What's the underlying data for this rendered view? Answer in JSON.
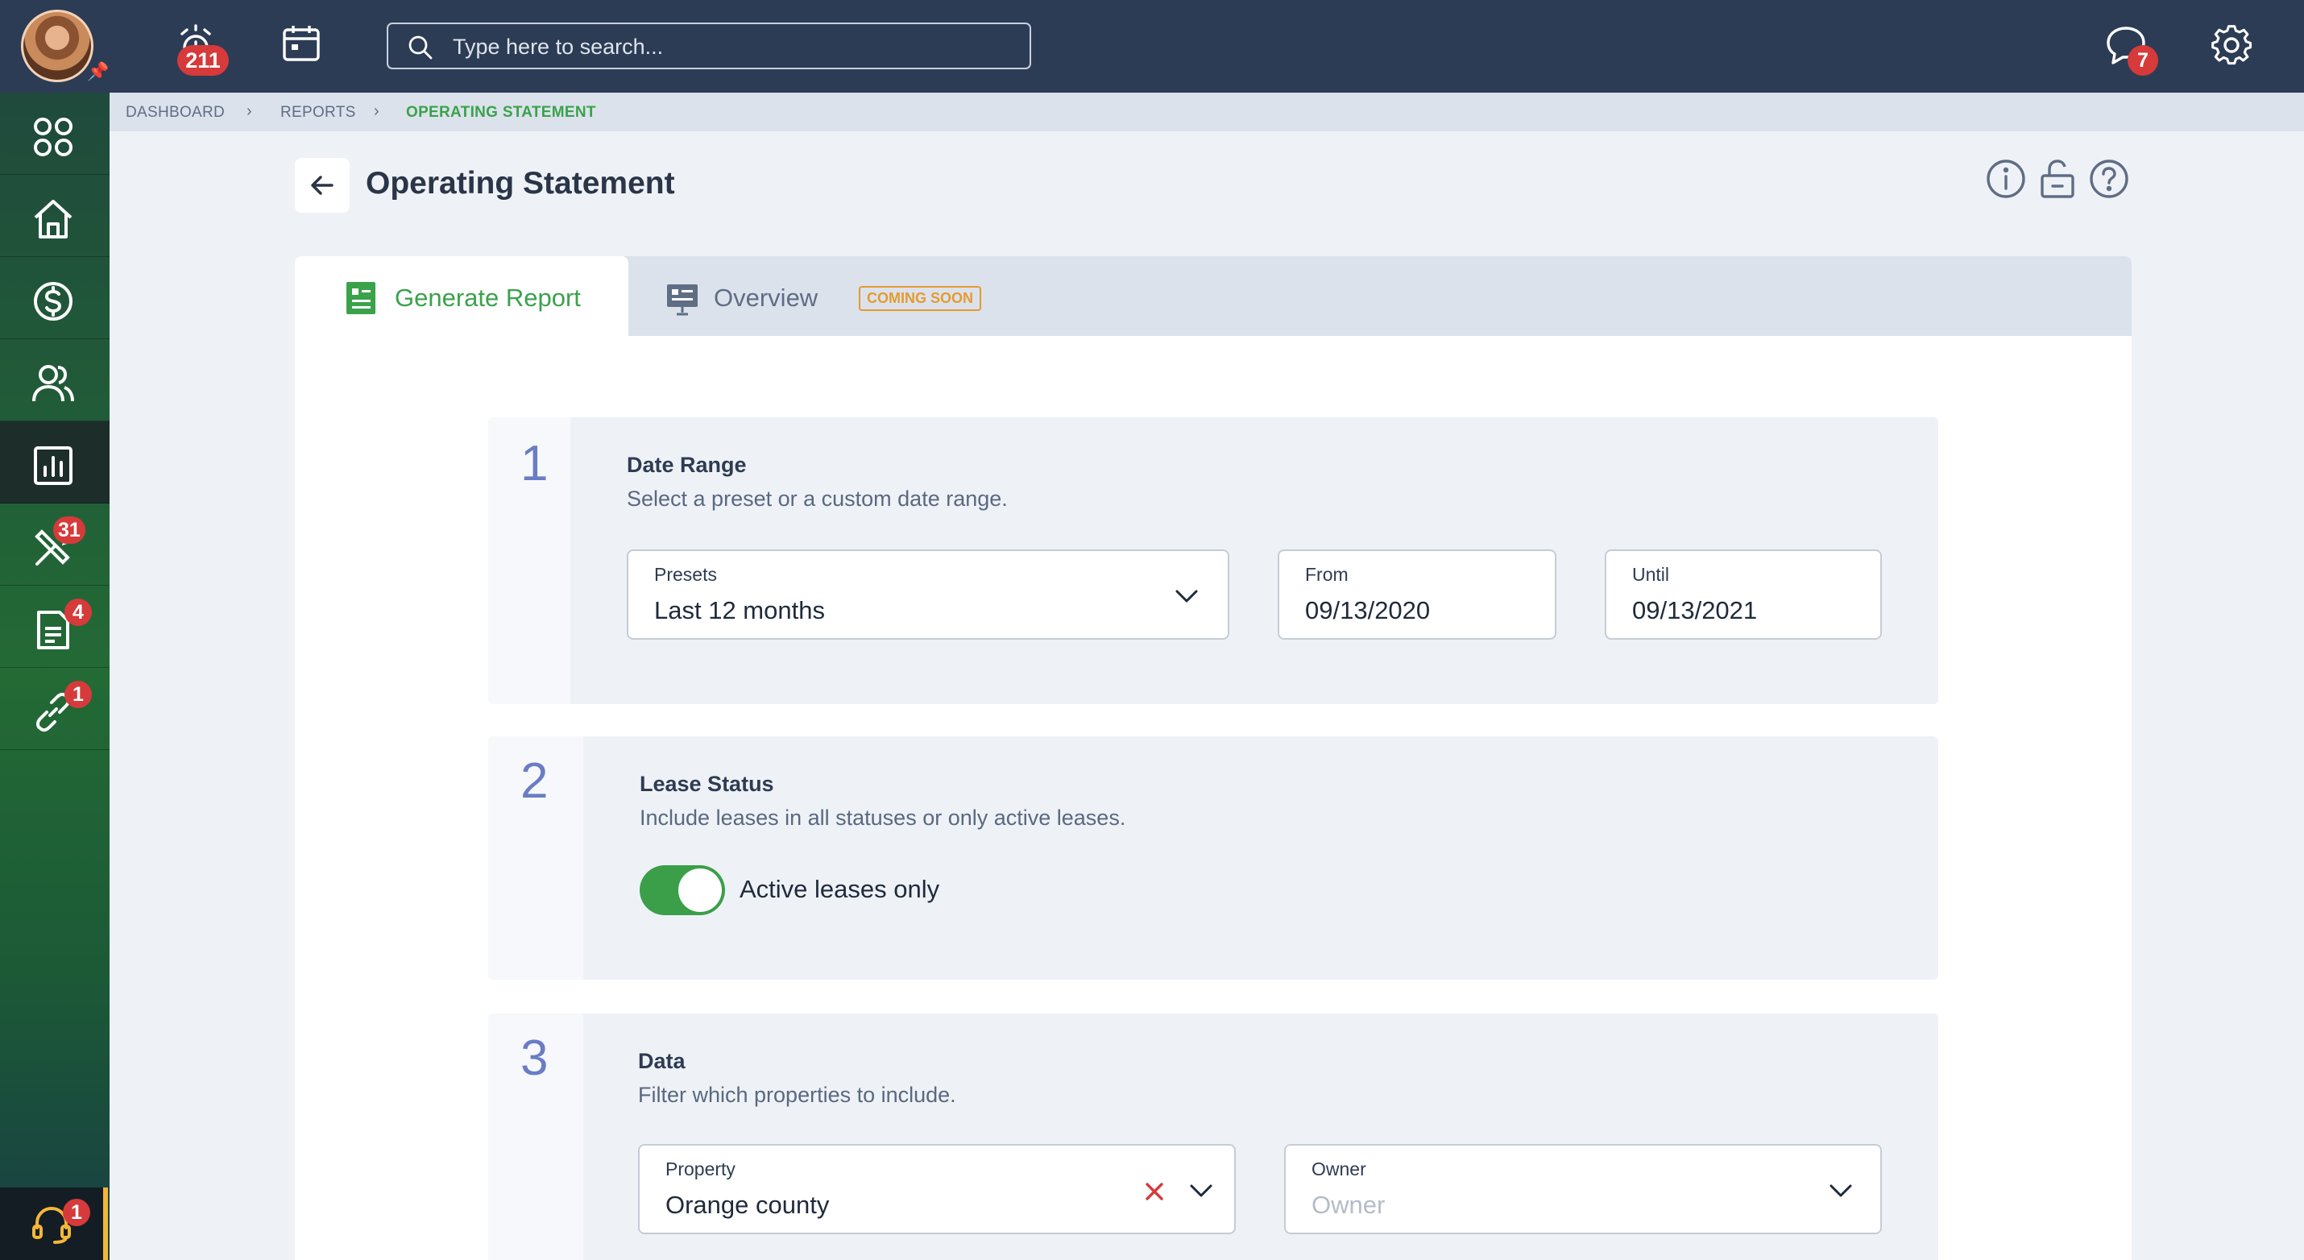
{
  "topbar": {
    "alarm_count": "211",
    "messages_count": "7",
    "search_placeholder": "Type here to search..."
  },
  "sidebar": {
    "maintenance_count": "31",
    "documents_count": "4",
    "integrations_count": "1",
    "support_count": "1"
  },
  "breadcrumb": {
    "items": [
      "DASHBOARD",
      "REPORTS",
      "OPERATING STATEMENT"
    ]
  },
  "page": {
    "title": "Operating Statement"
  },
  "tabs": {
    "generate": "Generate Report",
    "overview": "Overview",
    "coming_soon": "COMING SOON"
  },
  "steps": [
    {
      "number": "1",
      "title": "Date Range",
      "description": "Select a preset or a custom date range.",
      "presets_label": "Presets",
      "presets_value": "Last 12 months",
      "from_label": "From",
      "from_value": "09/13/2020",
      "until_label": "Until",
      "until_value": "09/13/2021"
    },
    {
      "number": "2",
      "title": "Lease Status",
      "description": "Include leases in all statuses or only active leases.",
      "toggle_label": "Active leases only",
      "toggle_on": true
    },
    {
      "number": "3",
      "title": "Data",
      "description": "Filter which properties to include.",
      "property_label": "Property",
      "property_value": "Orange county",
      "owner_label": "Owner",
      "owner_placeholder": "Owner"
    }
  ],
  "colors": {
    "topbar": "#2d3c55",
    "accent_green": "#3aa24a",
    "badge_red": "#d63a3a",
    "step_number": "#6a7dc4",
    "coming_soon": "#e49b2e"
  }
}
